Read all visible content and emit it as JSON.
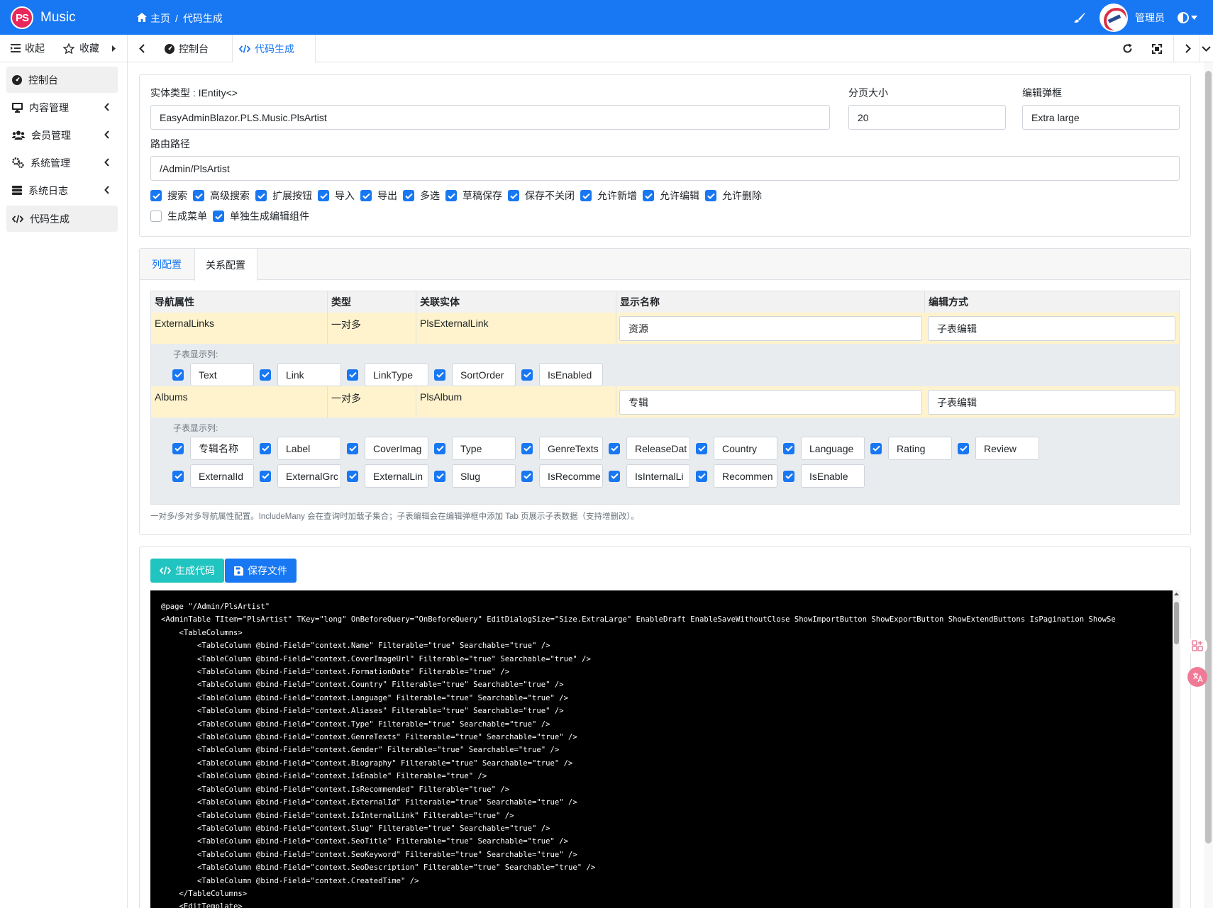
{
  "app": {
    "logo_text": "PS",
    "name": "Music",
    "accent": "#1877f2"
  },
  "breadcrumb": {
    "home": "主页",
    "separator": "/",
    "current": "代码生成"
  },
  "user": {
    "name": "管理员"
  },
  "toolbar": {
    "collapse": "收起",
    "favorites": "收藏"
  },
  "tabs": [
    {
      "label": "控制台"
    },
    {
      "label": "代码生成"
    }
  ],
  "sidebar": {
    "items": [
      {
        "label": "控制台"
      },
      {
        "label": "内容管理"
      },
      {
        "label": "会员管理"
      },
      {
        "label": "系统管理"
      },
      {
        "label": "系统日志"
      },
      {
        "label": "代码生成"
      }
    ]
  },
  "form": {
    "entity_label": "实体类型 : IEntity<>",
    "entity_value": "EasyAdminBlazor.PLS.Music.PlsArtist",
    "page_size_label": "分页大小",
    "page_size_value": "20",
    "dialog_label": "编辑弹框",
    "dialog_value": "Extra large",
    "route_label": "路由路径",
    "route_value": "/Admin/PlsArtist",
    "options_row1": [
      {
        "label": "搜索",
        "checked": true
      },
      {
        "label": "高级搜索",
        "checked": true
      },
      {
        "label": "扩展按钮",
        "checked": true
      },
      {
        "label": "导入",
        "checked": true
      },
      {
        "label": "导出",
        "checked": true
      },
      {
        "label": "多选",
        "checked": true
      },
      {
        "label": "草稿保存",
        "checked": true
      },
      {
        "label": "保存不关闭",
        "checked": true
      },
      {
        "label": "允许新增",
        "checked": true
      },
      {
        "label": "允许编辑",
        "checked": true
      },
      {
        "label": "允许删除",
        "checked": true
      }
    ],
    "options_row2": [
      {
        "label": "生成菜单",
        "checked": false
      },
      {
        "label": "单独生成编辑组件",
        "checked": true
      }
    ]
  },
  "config_tabs": {
    "columns": "列配置",
    "relations": "关系配置"
  },
  "relations": {
    "headers": [
      "导航属性",
      "类型",
      "关联实体",
      "显示名称",
      "编辑方式"
    ],
    "sub_label": "子表显示列:",
    "rows": [
      {
        "nav": "ExternalLinks",
        "type": "一对多",
        "entity": "PlsExternalLink",
        "display": "资源",
        "edit_mode": "子表编辑",
        "subcols": [
          "Text",
          "Link",
          "LinkType",
          "SortOrder",
          "IsEnabled"
        ]
      },
      {
        "nav": "Albums",
        "type": "一对多",
        "entity": "PlsAlbum",
        "display": "专辑",
        "edit_mode": "子表编辑",
        "subcols": [
          "专辑名称",
          "Label",
          "CoverImag",
          "Type",
          "GenreTexts",
          "ReleaseDat",
          "Country",
          "Language",
          "Rating",
          "Review",
          "ExternalId",
          "ExternalGrc",
          "ExternalLin",
          "Slug",
          "IsRecomme",
          "IsInternalLi",
          "Recommen",
          "IsEnable"
        ]
      }
    ],
    "hint": "一对多/多对多导航属性配置。IncludeMany 会在查询时加载子集合；子表编辑会在编辑弹框中添加 Tab 页展示子表数据（支持增删改）。"
  },
  "actions": {
    "generate": "生成代码",
    "save": "保存文件",
    "generate_color": "#20c4c0",
    "save_color": "#1877f2"
  },
  "code_lines": [
    "@page \"/Admin/PlsArtist\"",
    "<AdminTable TItem=\"PlsArtist\" TKey=\"long\" OnBeforeQuery=\"OnBeforeQuery\" EditDialogSize=\"Size.ExtraLarge\" EnableDraft EnableSaveWithoutClose ShowImportButton ShowExportButton ShowExtendButtons IsPagination ShowSe",
    "    <TableColumns>",
    "        <TableColumn @bind-Field=\"context.Name\" Filterable=\"true\" Searchable=\"true\" />",
    "        <TableColumn @bind-Field=\"context.CoverImageUrl\" Filterable=\"true\" Searchable=\"true\" />",
    "        <TableColumn @bind-Field=\"context.FormationDate\" Filterable=\"true\" />",
    "        <TableColumn @bind-Field=\"context.Country\" Filterable=\"true\" Searchable=\"true\" />",
    "        <TableColumn @bind-Field=\"context.Language\" Filterable=\"true\" Searchable=\"true\" />",
    "        <TableColumn @bind-Field=\"context.Aliases\" Filterable=\"true\" Searchable=\"true\" />",
    "        <TableColumn @bind-Field=\"context.Type\" Filterable=\"true\" Searchable=\"true\" />",
    "        <TableColumn @bind-Field=\"context.GenreTexts\" Filterable=\"true\" Searchable=\"true\" />",
    "        <TableColumn @bind-Field=\"context.Gender\" Filterable=\"true\" Searchable=\"true\" />",
    "        <TableColumn @bind-Field=\"context.Biography\" Filterable=\"true\" Searchable=\"true\" />",
    "        <TableColumn @bind-Field=\"context.IsEnable\" Filterable=\"true\" />",
    "        <TableColumn @bind-Field=\"context.IsRecommended\" Filterable=\"true\" />",
    "        <TableColumn @bind-Field=\"context.ExternalId\" Filterable=\"true\" Searchable=\"true\" />",
    "        <TableColumn @bind-Field=\"context.IsInternalLink\" Filterable=\"true\" />",
    "        <TableColumn @bind-Field=\"context.Slug\" Filterable=\"true\" Searchable=\"true\" />",
    "        <TableColumn @bind-Field=\"context.SeoTitle\" Filterable=\"true\" Searchable=\"true\" />",
    "        <TableColumn @bind-Field=\"context.SeoKeyword\" Filterable=\"true\" Searchable=\"true\" />",
    "        <TableColumn @bind-Field=\"context.SeoDescription\" Filterable=\"true\" Searchable=\"true\" />",
    "        <TableColumn @bind-Field=\"context.CreatedTime\" />",
    "    </TableColumns>",
    "    <EditTemplate>"
  ]
}
